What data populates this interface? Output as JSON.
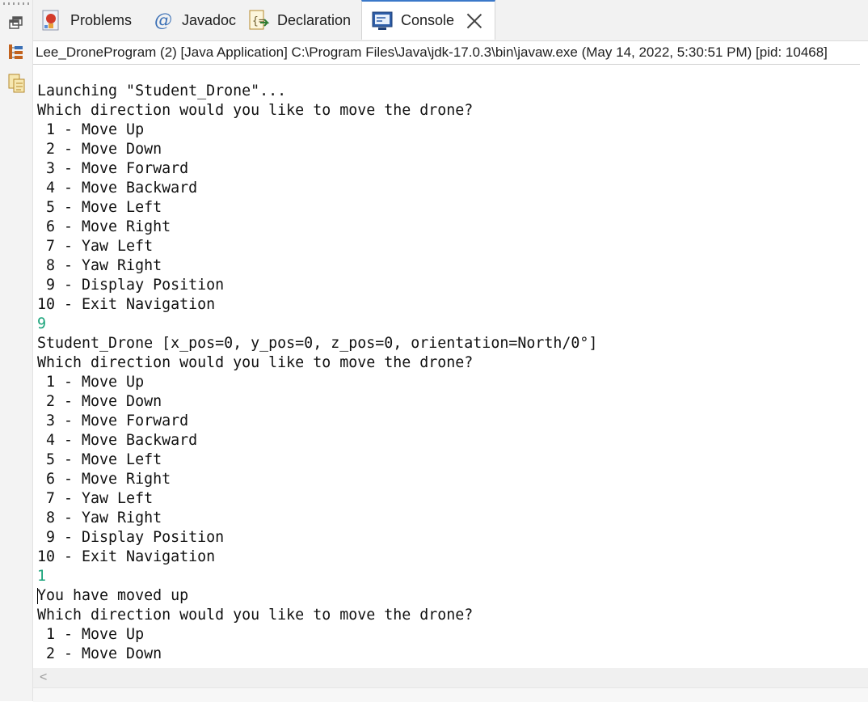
{
  "tabs": [
    {
      "label": "Problems",
      "icon": "problems-icon",
      "active": false
    },
    {
      "label": "Javadoc",
      "icon": "at-icon",
      "active": false
    },
    {
      "label": "Declaration",
      "icon": "declaration-icon",
      "active": false
    },
    {
      "label": "Console",
      "icon": "console-icon",
      "active": true
    }
  ],
  "launch_info": "Lee_DroneProgram (2) [Java Application] C:\\Program Files\\Java\\jdk-17.0.3\\bin\\javaw.exe  (May 14, 2022, 5:30:51 PM) [pid: 10468]",
  "colors": {
    "input_text": "#19a37a",
    "active_tab_accent": "#3a78c9"
  },
  "console": {
    "lines": [
      {
        "text": "Launching \"Student_Drone\"...",
        "type": "output"
      },
      {
        "text": "Which direction would you like to move the drone?",
        "type": "output"
      },
      {
        "text": " 1 - Move Up",
        "type": "output"
      },
      {
        "text": " 2 - Move Down",
        "type": "output"
      },
      {
        "text": " 3 - Move Forward",
        "type": "output"
      },
      {
        "text": " 4 - Move Backward",
        "type": "output"
      },
      {
        "text": " 5 - Move Left",
        "type": "output"
      },
      {
        "text": " 6 - Move Right",
        "type": "output"
      },
      {
        "text": " 7 - Yaw Left",
        "type": "output"
      },
      {
        "text": " 8 - Yaw Right",
        "type": "output"
      },
      {
        "text": " 9 - Display Position",
        "type": "output"
      },
      {
        "text": "10 - Exit Navigation",
        "type": "output"
      },
      {
        "text": "9",
        "type": "input"
      },
      {
        "text": "Student_Drone [x_pos=0, y_pos=0, z_pos=0, orientation=North/0°]",
        "type": "output"
      },
      {
        "text": "Which direction would you like to move the drone?",
        "type": "output"
      },
      {
        "text": " 1 - Move Up",
        "type": "output"
      },
      {
        "text": " 2 - Move Down",
        "type": "output"
      },
      {
        "text": " 3 - Move Forward",
        "type": "output"
      },
      {
        "text": " 4 - Move Backward",
        "type": "output"
      },
      {
        "text": " 5 - Move Left",
        "type": "output"
      },
      {
        "text": " 6 - Move Right",
        "type": "output"
      },
      {
        "text": " 7 - Yaw Left",
        "type": "output"
      },
      {
        "text": " 8 - Yaw Right",
        "type": "output"
      },
      {
        "text": " 9 - Display Position",
        "type": "output"
      },
      {
        "text": "10 - Exit Navigation",
        "type": "output"
      },
      {
        "text": "1",
        "type": "input"
      },
      {
        "text": "You have moved up",
        "type": "output"
      },
      {
        "text": "Which direction would you like to move the drone?",
        "type": "output"
      },
      {
        "text": " 1 - Move Up",
        "type": "output"
      },
      {
        "text": " 2 - Move Down",
        "type": "output"
      }
    ]
  },
  "scrollbar": {
    "left_arrow": "<"
  }
}
